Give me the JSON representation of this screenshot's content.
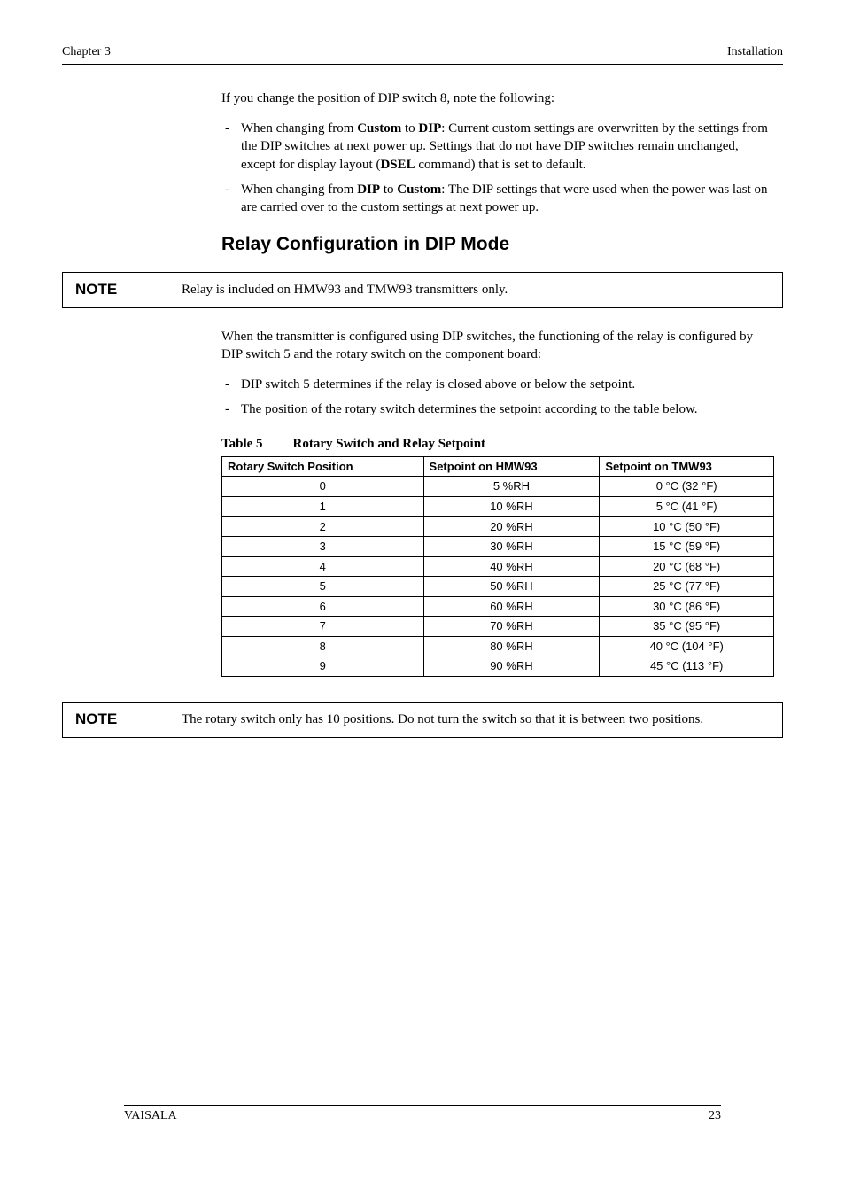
{
  "header": {
    "left": "Chapter 3",
    "right": "Installation",
    "rule_fill": "______________________________________________________________"
  },
  "intro_para": "If you change the position of DIP switch 8, note the following:",
  "intro_bullets": [
    "When changing from <b>Custom</b> to <b>DIP</b>: Current custom settings are overwritten by the settings from the DIP switches at next power up. Settings that do not have DIP switches remain unchanged, except for display layout (<b>DSEL</b> command) that is set to default.",
    "When changing from <b>DIP</b> to <b>Custom</b>:  The DIP settings that were used when the power was last on are carried over to the custom settings at next power up."
  ],
  "section_heading": "Relay Configuration in DIP Mode",
  "note1": {
    "label": "NOTE",
    "text": "Relay is included on HMW93 and TMW93 transmitters only."
  },
  "config_para": "When the transmitter is configured using DIP switches, the functioning of the relay is configured by DIP switch 5 and the rotary switch on the component board:",
  "config_bullets": [
    "DIP switch 5 determines if the relay is closed above or below the setpoint.",
    "The position of the rotary switch determines the setpoint according to the table below."
  ],
  "table": {
    "number": "Table 5",
    "title": "Rotary Switch and Relay Setpoint",
    "headers": [
      "Rotary Switch Position",
      "Setpoint on HMW93",
      "Setpoint on TMW93"
    ],
    "rows": [
      [
        "0",
        "5 %RH",
        "0 °C (32 °F)"
      ],
      [
        "1",
        "10 %RH",
        "5 °C (41 °F)"
      ],
      [
        "2",
        "20 %RH",
        "10 °C (50 °F)"
      ],
      [
        "3",
        "30 %RH",
        "15 °C (59 °F)"
      ],
      [
        "4",
        "40 %RH",
        "20 °C (68 °F)"
      ],
      [
        "5",
        "50 %RH",
        "25 °C (77 °F)"
      ],
      [
        "6",
        "60 %RH",
        "30 °C (86 °F)"
      ],
      [
        "7",
        "70 %RH",
        "35 °C (95 °F)"
      ],
      [
        "8",
        "80 %RH",
        "40 °C (104 °F)"
      ],
      [
        "9",
        "90 %RH",
        "45 °C (113 °F)"
      ]
    ]
  },
  "note2": {
    "label": "NOTE",
    "text": "The rotary switch only has 10 positions. Do not turn the switch so that it is between two positions."
  },
  "footer": {
    "left": "VAISALA",
    "right": "23",
    "rule_fill": "_______________________________________________________________________"
  }
}
